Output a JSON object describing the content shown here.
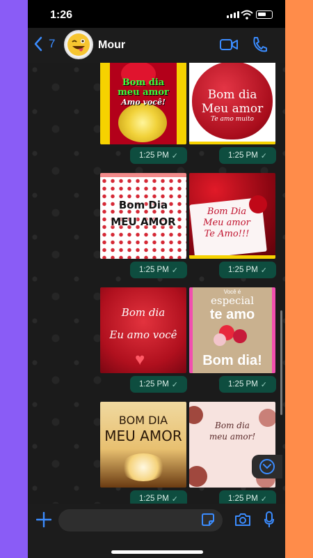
{
  "status_bar": {
    "time": "1:26"
  },
  "header": {
    "back_count": "7",
    "contact_name": "Mour",
    "avatar_emoji": "😜"
  },
  "messages": [
    {
      "left": {
        "lines": [
          "Bom dia",
          "meu amor",
          "Amo você!"
        ],
        "time": "1:25 PM"
      },
      "right": {
        "lines": [
          "Bom dia",
          "Meu amor",
          "Te amo muito"
        ],
        "time": "1:25 PM"
      }
    },
    {
      "left": {
        "lines": [
          "Bom Dia",
          "MEU AMOR"
        ],
        "time": "1:25 PM"
      },
      "right": {
        "lines": [
          "Bom Dia",
          "Meu amor",
          "Te Amo!!!"
        ],
        "time": "1:25 PM"
      }
    },
    {
      "left": {
        "lines": [
          "Bom dia",
          "Eu amo você"
        ],
        "time": "1:25 PM"
      },
      "right": {
        "lines": [
          "Você é",
          "especial",
          "te amo",
          "Bom dia!"
        ],
        "time": "1:25 PM"
      }
    },
    {
      "left": {
        "lines": [
          "BOM DIA",
          "MEU AMOR"
        ],
        "time": "1:25 PM"
      },
      "right": {
        "lines": [
          "Bom dia",
          "meu amor!"
        ],
        "time": "1:25 PM"
      }
    }
  ],
  "input": {
    "placeholder": ""
  },
  "colors": {
    "accent": "#3b8cff",
    "bubble": "#0e4d3f"
  },
  "icons": [
    "back-chevron-icon",
    "video-call-icon",
    "phone-call-icon",
    "plus-icon",
    "sticker-icon",
    "camera-icon",
    "microphone-icon",
    "scroll-down-icon"
  ]
}
